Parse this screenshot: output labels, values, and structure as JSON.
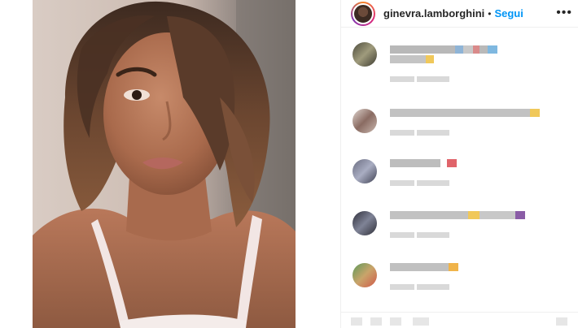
{
  "header": {
    "username": "ginevra.lamborghini",
    "separator": "•",
    "follow_label": "Segui",
    "more_icon": "more-horizontal-icon"
  },
  "colors": {
    "follow_blue": "#0095f6",
    "text": "#262626",
    "border": "#efefef"
  },
  "comments_note_icons": [
    "heart-icon",
    "comment-icon",
    "share-icon",
    "bookmark-icon"
  ]
}
